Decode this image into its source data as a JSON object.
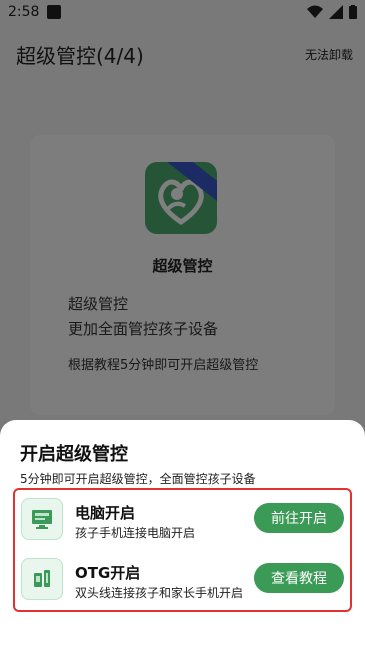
{
  "status_bar": {
    "time": "2:58",
    "battery_glyph": "battery-icon"
  },
  "app_bar": {
    "title": "超级管控(4/4)",
    "action": "无法卸载"
  },
  "card": {
    "app_name": "超级管控",
    "desc_line1": "超级管控",
    "desc_line2": "更加全面管控孩子设备",
    "tip": "根据教程5分钟即可开启超级管控"
  },
  "sheet": {
    "title": "开启超级管控",
    "subtitle": "5分钟即可开启超级管控，全面管控孩子设备",
    "options": [
      {
        "title": "电脑开启",
        "desc": "孩子手机连接电脑开启",
        "button": "前往开启",
        "icon": "computer-icon"
      },
      {
        "title": "OTG开启",
        "desc": "双头线连接孩子和家长手机开启",
        "button": "查看教程",
        "icon": "otg-icon"
      }
    ]
  },
  "colors": {
    "accent": "#3a9a56",
    "highlight_border": "#e0332f",
    "logo": "#4aa86c"
  }
}
